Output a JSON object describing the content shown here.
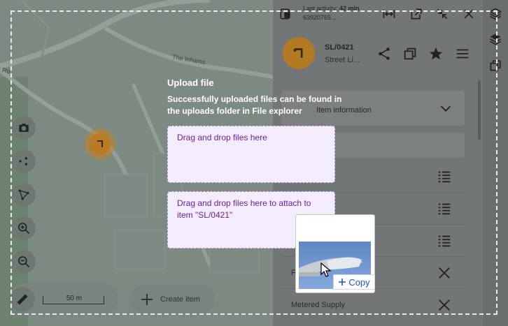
{
  "map": {
    "street_labels": [
      "The Inhams",
      "Ro"
    ],
    "scale_label": "50 m",
    "create_item_label": "Create item"
  },
  "topbar": {
    "activity_prefix": "Last activity:",
    "activity_value": "42 min",
    "item_id": "63920765..."
  },
  "item": {
    "code": "SL/0421",
    "type": "Street Li..."
  },
  "panel": {
    "section_title_partial": "Item information",
    "rows": [
      {
        "label": ""
      },
      {
        "label": ""
      },
      {
        "label": ""
      },
      {
        "label": "F"
      },
      {
        "label": "Metered Supply"
      }
    ]
  },
  "upload": {
    "title": "Upload file",
    "subtitle": "Successfully uploaded files can be found in the uploads folder in File explorer",
    "drop_files": "Drag and drop files here",
    "drop_attach": "Drag and drop files here to attach to item \"SL/0421\""
  },
  "drag": {
    "copy_label": "Copy"
  },
  "colors": {
    "accent": "#6b1fa8",
    "marker": "#b87a25",
    "copy_blue": "#1a56c9"
  }
}
